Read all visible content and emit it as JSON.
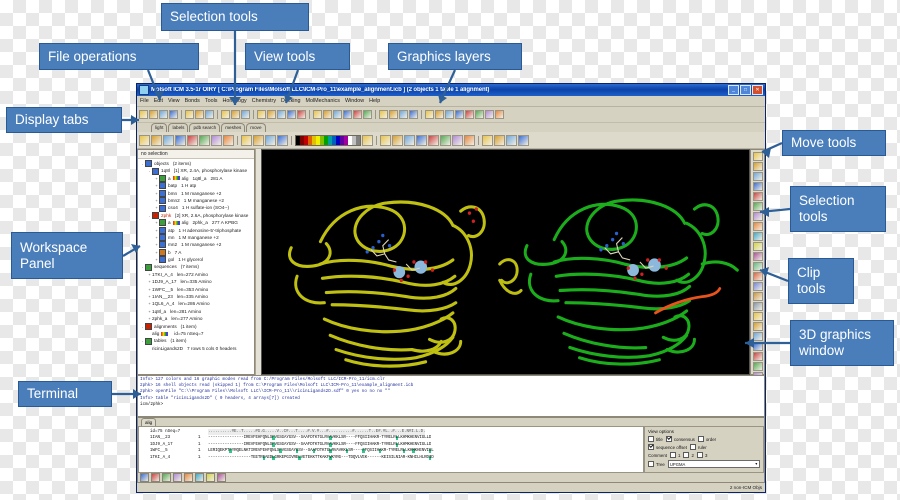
{
  "annotations": [
    {
      "id": "file-operations",
      "label": "File operations"
    },
    {
      "id": "selection-tools-top",
      "label": "Selection tools"
    },
    {
      "id": "view-tools",
      "label": "View tools"
    },
    {
      "id": "graphics-layers",
      "label": "Graphics layers"
    },
    {
      "id": "display-tabs",
      "label": "Display tabs"
    },
    {
      "id": "workspace-panel",
      "label": "Workspace\nPanel"
    },
    {
      "id": "terminal",
      "label": "Terminal"
    },
    {
      "id": "move-tools",
      "label": "Move tools"
    },
    {
      "id": "selection-tools-right",
      "label": "Selection\ntools"
    },
    {
      "id": "clip-tools",
      "label": "Clip\ntools"
    },
    {
      "id": "graphics-window",
      "label": "3D graphics\nwindow"
    }
  ],
  "annotation_color": "#4a7ebb",
  "window": {
    "title": "Molsoft ICM 3.5-1r OIRY [ C:\\Program Files\\Molsoft LLC\\ICM-Pro_11\\example_alignment.icb ] (2 objects 1 table 1 alignment)",
    "buttons": {
      "minimize": "_",
      "maximize": "□",
      "close": "✕"
    },
    "menu": [
      "File",
      "Edit",
      "View",
      "Bonds",
      "Tools",
      "Homology",
      "Chemistry",
      "Docking",
      "MolMechanics",
      "Window",
      "Help"
    ]
  },
  "display_tabs": [
    "light",
    "labels",
    "pdb search",
    "meshes",
    "move"
  ],
  "workspace": {
    "header": "no selection",
    "tree": [
      {
        "indent": 0,
        "twisty": "-",
        "box": "#3b6fd4",
        "label": "objects",
        "desc": "(2 items)",
        "chip": false,
        "red": false
      },
      {
        "indent": 1,
        "twisty": "-",
        "box": "#3b6fd4",
        "label": "1q8l",
        "desc": "[1] XR, 2.4A, phosphorylase kinase",
        "chip": false,
        "red": false
      },
      {
        "indent": 2,
        "twisty": "+",
        "box": "#3ba03b",
        "label": "a",
        "desc": "1q8l_a",
        "chip": true,
        "chiptext": "alig",
        "extra": "281 A",
        "red": false
      },
      {
        "indent": 2,
        "twisty": "+",
        "box": "#3b6fd4",
        "label": "batp",
        "desc": "1 H  atp",
        "chip": false,
        "red": false
      },
      {
        "indent": 2,
        "twisty": "+",
        "box": "#3b6fd4",
        "label": "bmn",
        "desc": "1 M  manganese +2",
        "chip": false,
        "red": false
      },
      {
        "indent": 2,
        "twisty": "+",
        "box": "#3b6fd4",
        "label": "bmn2",
        "desc": "1 M  manganese +2",
        "chip": false,
        "red": false
      },
      {
        "indent": 2,
        "twisty": "+",
        "box": "#3b6fd4",
        "label": "cso4",
        "desc": "1 H  sulfate-ion (SO4--)",
        "chip": false,
        "red": false
      },
      {
        "indent": 1,
        "twisty": "-",
        "box": "#cc2200",
        "label": "2phk",
        "desc": "[2] XR, 2.6A, phosphorylase kinase",
        "chip": false,
        "red": true
      },
      {
        "indent": 2,
        "twisty": "+",
        "box": "#3ba03b",
        "label": "a",
        "desc": "2phk_a",
        "chip": true,
        "chiptext": "alig",
        "extra": "277 A KPBG",
        "red": false
      },
      {
        "indent": 2,
        "twisty": "+",
        "box": "#3b6fd4",
        "label": "atp",
        "desc": "1 H  adenosine-5'-triphosphate",
        "chip": false,
        "red": false
      },
      {
        "indent": 2,
        "twisty": "+",
        "box": "#3b6fd4",
        "label": "mn",
        "desc": "1 M  manganese +2",
        "chip": false,
        "red": false
      },
      {
        "indent": 2,
        "twisty": "+",
        "box": "#3b6fd4",
        "label": "mn2",
        "desc": "1 M  manganese +2",
        "chip": false,
        "red": false
      },
      {
        "indent": 2,
        "twisty": "+",
        "box": "#cc7722",
        "label": "b",
        "desc": "7 A",
        "chip": false,
        "red": false
      },
      {
        "indent": 2,
        "twisty": "+",
        "box": "#3b6fd4",
        "label": "gol",
        "desc": "1 H  glycerol",
        "chip": false,
        "red": false
      },
      {
        "indent": 0,
        "twisty": "-",
        "box": "#3ba03b",
        "label": "sequences",
        "desc": "(7 items)",
        "chip": false,
        "red": false
      },
      {
        "indent": 1,
        "twisty": "+",
        "box": "",
        "label": "1TKI_A_4",
        "desc": "len=272 Amino",
        "chip": false,
        "red": false
      },
      {
        "indent": 1,
        "twisty": "+",
        "box": "",
        "label": "1DJ9_A_17",
        "desc": "len=335 Amino",
        "chip": false,
        "red": false
      },
      {
        "indent": 1,
        "twisty": "+",
        "box": "",
        "label": "1WFC__5",
        "desc": "len=353 Amino",
        "chip": false,
        "red": false
      },
      {
        "indent": 1,
        "twisty": "+",
        "box": "",
        "label": "1IAN__23",
        "desc": "len=335 Amino",
        "chip": false,
        "red": false
      },
      {
        "indent": 1,
        "twisty": "+",
        "box": "",
        "label": "1QL6_A_4",
        "desc": "len=286 Amino",
        "chip": false,
        "red": false
      },
      {
        "indent": 1,
        "twisty": "+",
        "box": "",
        "label": "1q8l_a",
        "desc": "len=281 Amino",
        "chip": false,
        "red": false
      },
      {
        "indent": 1,
        "twisty": "+",
        "box": "",
        "label": "2phk_a",
        "desc": "len=277 Amino",
        "chip": false,
        "red": false
      },
      {
        "indent": 0,
        "twisty": "-",
        "box": "#cc2200",
        "label": "alignments",
        "desc": "(1 item)",
        "chip": false,
        "red": false
      },
      {
        "indent": 1,
        "twisty": "",
        "box": "",
        "label": "alig",
        "desc": "id=75 nSeq=7",
        "chip": true,
        "chiptext": "",
        "red": false
      },
      {
        "indent": 0,
        "twisty": "-",
        "box": "#3ba03b",
        "label": "tables",
        "desc": "(1 item)",
        "chip": false,
        "red": false
      },
      {
        "indent": 1,
        "twisty": "",
        "box": "",
        "label": "ricinLigands2D",
        "desc": "7 rows 5 cols 0 headers",
        "chip": false,
        "red": false
      }
    ]
  },
  "terminal": {
    "lines": [
      {
        "text": "Info> 127 colors and 16 graphic modes read from C:/Program Files/Molsoft LLC/ICM-Pro_11/icm.clr",
        "kind": "info"
      },
      {
        "text": "2phk> 16 shell objects read (skipped 1) from C:\\Program Files\\Molsoft LLC\\ICM-Pro_11\\example_alignment.icb",
        "kind": "info"
      },
      {
        "text": "2phk> openFile \"C:\\\\Program Files\\\\Molsoft LLC\\\\ICM-Pro_11\\\\ricinLigands2D.sdf\" 0 yes no no no \"\"",
        "kind": "info"
      },
      {
        "text": "Info> table \"ricinLigands2D\"  ( 0 headers, 4 arrays[7]) created",
        "kind": "info"
      },
      {
        "text": "icm/2phk>",
        "kind": "prompt"
      }
    ]
  },
  "alignment": {
    "tabs": [
      "alig"
    ],
    "rows": [
      {
        "name": "id=75 nSeq=7",
        "num": "",
        "residues": "..........#E..T.....#G.G.....V..C#...T....#.V.#...#..........#......T..E#.#L..#...E.N#I.L.D.",
        "consensus": true
      },
      {
        "name": "1IAN__23",
        "num": "1",
        "residues": "---------------IREVFEHFQNLSFVGSGAYGSV--SAAFDTKTGLRVAVKKLSR----FFQSIIHAKR-TYRELRLLKHMKHENVIGLLD",
        "consensus": false
      },
      {
        "name": "1DJ9_A_17",
        "num": "1",
        "residues": "---------------IREVFEHFQNLSFVGSGAYGSV--SAAFDTKTGLRVAVKKLSR----FFQSIIHAKR-TYRELRLLKHMKHENVIGLLD",
        "consensus": false
      },
      {
        "name": "1WFC__5",
        "num": "1",
        "residues": "LERIQEKPTFYRQELNKTIREVFEHFQNLSFVGSGAYGSV--SAAFDTKTGLRVAVKKLSR----FFQSIIHAKR-TYRELRLLKHMKHENVIGL",
        "consensus": false
      },
      {
        "name": "1TKI_A_4",
        "num": "1",
        "residues": "------------------TEETRIAEDLGRKEPGIVRELVETEKKTTKAKFVKYRG---TDQVLVEK------KEISILNIAR-KNHILHLRDID",
        "consensus": false
      }
    ]
  },
  "view_options": {
    "title": "View options",
    "checks": [
      {
        "label": "title",
        "checked": false
      },
      {
        "label": "consensus",
        "checked": true
      },
      {
        "label": "order",
        "checked": false
      },
      {
        "label": "sequence offset",
        "checked": true
      },
      {
        "label": "ruler",
        "checked": false
      },
      {
        "label": "Tree",
        "checked": false
      }
    ],
    "comment_label": "Comment",
    "comments": [
      {
        "label": "1",
        "checked": false
      },
      {
        "label": "2",
        "checked": false
      },
      {
        "label": "3",
        "checked": false
      }
    ],
    "tree_method": "UPGMA"
  },
  "statusbar": {
    "text": "2 non-ICM Objs"
  },
  "graphics": {
    "left_structure_color": "#c8c814",
    "right_structure_color": "#1eb51e",
    "highlight_color": "#e8541b",
    "background": "#000000",
    "metal_color": "#8cb8dc"
  }
}
